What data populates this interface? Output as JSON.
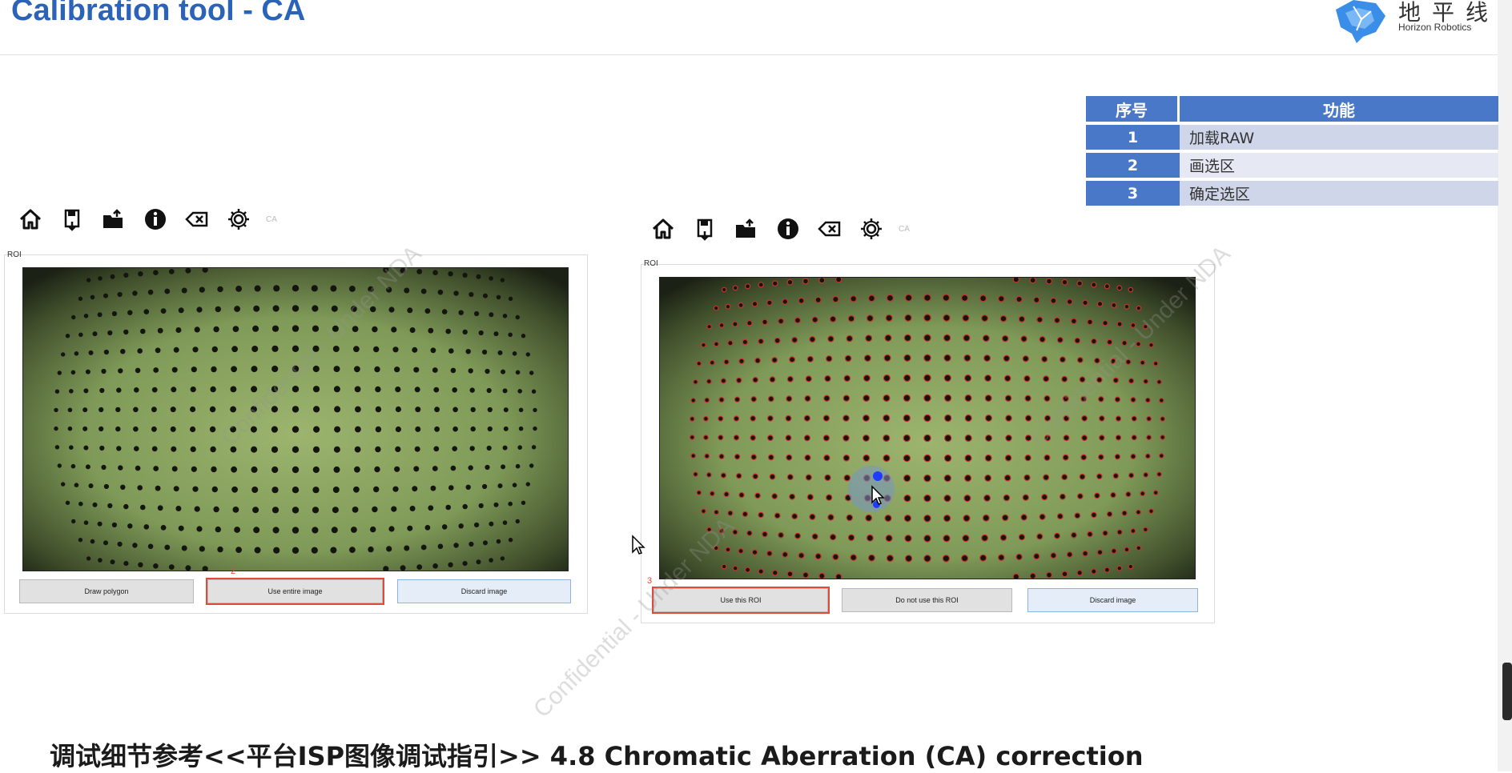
{
  "header": {
    "title": "Calibration tool - CA",
    "logo_cn": "地平线",
    "logo_en": "Horizon Robotics"
  },
  "function_table": {
    "headers": [
      "序号",
      "功能"
    ],
    "rows": [
      {
        "num": "1",
        "text": "加载RAW"
      },
      {
        "num": "2",
        "text": "画选区"
      },
      {
        "num": "3",
        "text": "确定选区"
      }
    ]
  },
  "toolbar": {
    "icons": [
      "home-icon",
      "save-icon",
      "open-folder-icon",
      "info-icon",
      "delete-icon",
      "settings-icon"
    ],
    "label": "CA"
  },
  "left_panel": {
    "label": "ROI",
    "buttons": {
      "draw": "Draw polygon",
      "use_entire": "Use entire image",
      "discard": "Discard image"
    },
    "marker": "2"
  },
  "right_panel": {
    "label": "ROI",
    "buttons": {
      "use_roi": "Use this ROI",
      "not_use": "Do not use this ROI",
      "discard": "Discard image"
    },
    "marker": "3"
  },
  "watermark": "Confidential - Under NDA",
  "caption": "调试细节参考<<平台ISP图像调试指引>>  4.8 Chromatic Aberration (CA) correction",
  "colors": {
    "title_blue": "#2a63b8",
    "table_blue": "#4a78c9",
    "highlight_red": "#e04a3a",
    "chart_green": "#7f9a58"
  }
}
